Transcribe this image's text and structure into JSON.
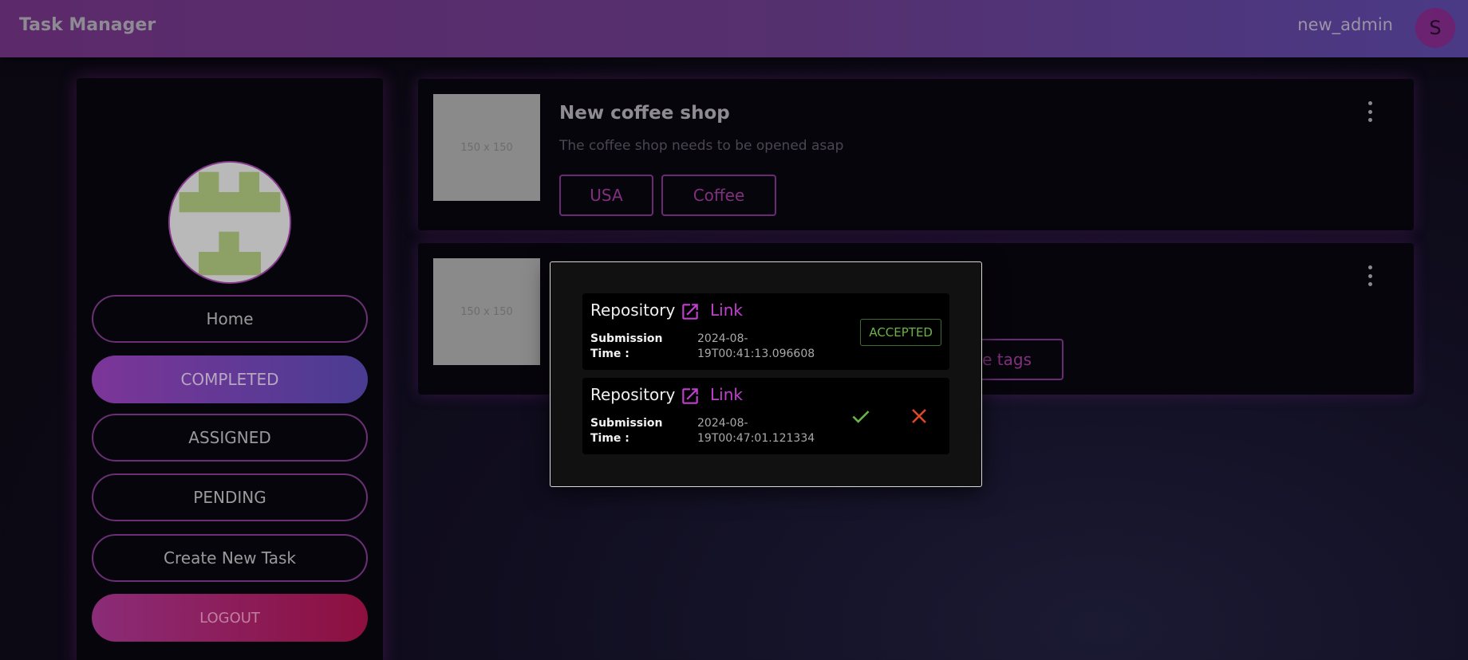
{
  "header": {
    "app_title": "Task Manager",
    "username": "new_admin",
    "avatar_initial": "S"
  },
  "sidebar": {
    "items": [
      {
        "label": "Home"
      },
      {
        "label": "COMPLETED",
        "active": true
      },
      {
        "label": "ASSIGNED"
      },
      {
        "label": "PENDING"
      },
      {
        "label": "Create New Task"
      }
    ],
    "logout_label": "LOGOUT"
  },
  "tasks": [
    {
      "thumbnail_text": "150 x 150",
      "title": "New coffee shop",
      "description": "The coffee shop needs to be opened asap",
      "tags": [
        "USA",
        "Coffee"
      ]
    },
    {
      "thumbnail_text": "150 x 150",
      "partial_tag_text": "e tags"
    }
  ],
  "modal": {
    "submissions": [
      {
        "repo_label": "Repository",
        "link_label": "Link",
        "time_label": "Submission Time :",
        "time_value": "2024-08-19T00:41:13.096608",
        "status": "ACCEPTED"
      },
      {
        "repo_label": "Repository",
        "link_label": "Link",
        "time_label": "Submission Time :",
        "time_value": "2024-08-19T00:47:01.121334"
      }
    ]
  },
  "colors": {
    "accent": "#c13fcf",
    "accepted": "#6bb349",
    "reject": "#e0452f"
  }
}
